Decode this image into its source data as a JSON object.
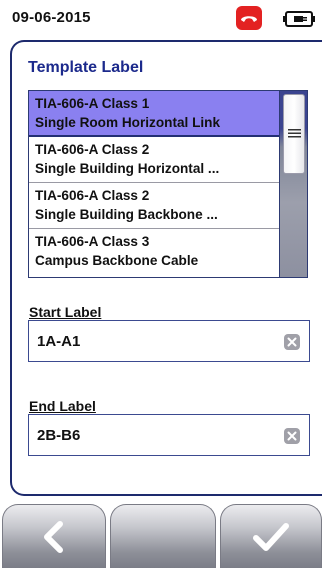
{
  "status": {
    "date": "09-06-2015",
    "colors": {
      "call_badge": "#e32222"
    }
  },
  "icons": {
    "call": "phone-hangup-icon",
    "battery": "battery-plug-icon",
    "back": "chevron-left-icon",
    "confirm": "checkmark-icon",
    "clear": "clear-x-icon",
    "grip": "scroll-grip-icon"
  },
  "panel": {
    "title": "Template Label"
  },
  "template_list": {
    "items": [
      {
        "line1": "TIA-606-A Class 1",
        "line2": "Single Room Horizontal Link",
        "selected": true
      },
      {
        "line1": "TIA-606-A Class 2",
        "line2": "Single Building Horizontal ...",
        "selected": false
      },
      {
        "line1": "TIA-606-A Class 2",
        "line2": "Single Building Backbone ...",
        "selected": false
      },
      {
        "line1": "TIA-606-A Class 3",
        "line2": "Campus Backbone Cable",
        "selected": false
      }
    ],
    "selection_color": "#8a80f0"
  },
  "start": {
    "label": "Start Label",
    "value": "1A-A1"
  },
  "end": {
    "label": "End Label",
    "value": "2B-B6"
  }
}
